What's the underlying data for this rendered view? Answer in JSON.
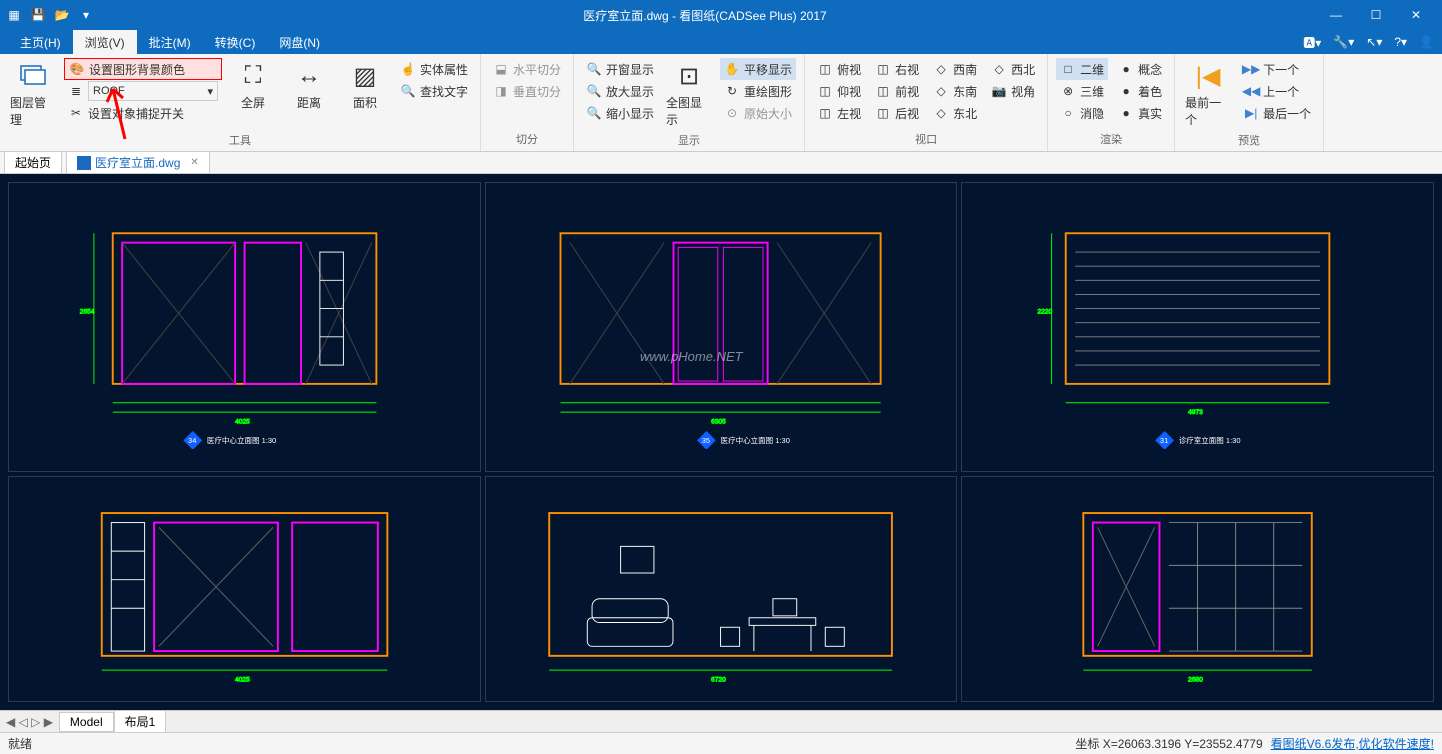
{
  "title": "医疗室立面.dwg - 看图纸(CADSee Plus) 2017",
  "menus": {
    "home": "主页(H)",
    "view": "浏览(V)",
    "annotate": "批注(M)",
    "convert": "转换(C)",
    "cloud": "网盘(N)"
  },
  "ribbon": {
    "layer_manage": "图层管理",
    "set_bg_color": "设置图形背景颜色",
    "layer_select_label": "ROOF",
    "set_snap": "设置对象捕捉开关",
    "fullscreen": "全屏",
    "distance": "距离",
    "area": "面积",
    "entity_props": "实体属性",
    "find_text": "查找文字",
    "h_split": "水平切分",
    "v_split": "垂直切分",
    "zoom_window": "开窗显示",
    "zoom_in": "放大显示",
    "zoom_out": "缩小显示",
    "zoom_extents": "全图显示",
    "pan": "平移显示",
    "redraw": "重绘图形",
    "original_size": "原始大小",
    "top_view": "俯视",
    "bottom_view": "仰视",
    "left_view": "左视",
    "right_view": "右视",
    "front_view": "前视",
    "back_view": "后视",
    "sw_view": "西南",
    "se_view": "东南",
    "ne_view": "东北",
    "nw_view": "西北",
    "view_angle": "视角",
    "view_2d": "二维",
    "view_3d": "三维",
    "hide": "消隐",
    "concept": "概念",
    "color": "着色",
    "real": "真实",
    "prev": "最前一个",
    "next1": "下一个",
    "prev1": "上一个",
    "last": "最后一个",
    "group_tools": "工具",
    "group_split": "切分",
    "group_display": "显示",
    "group_viewport": "视口",
    "group_render": "渲染",
    "group_preview": "预览"
  },
  "doc_tabs": {
    "start": "起始页",
    "file": "医疗室立面.dwg"
  },
  "layout_tabs": {
    "model": "Model",
    "layout1": "布局1"
  },
  "status": {
    "ready": "就绪",
    "coords": "坐标 X=26063.3196 Y=23552.4779",
    "link": "看图纸V6.6发布,优化软件速度!"
  },
  "watermark": "www.pHome.NET",
  "drawings": {
    "d34": {
      "num": "34",
      "label": "医疗中心立面图 1:30"
    },
    "d35": {
      "num": "35",
      "label": "医疗中心立面图 1:30"
    },
    "d31": {
      "num": "31",
      "label": "诊疗室立面图 1:30"
    }
  }
}
